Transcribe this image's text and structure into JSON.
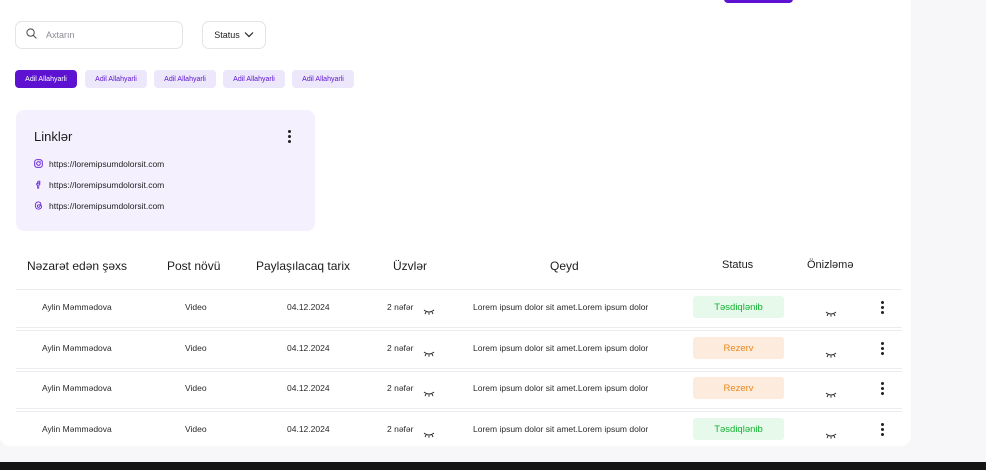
{
  "search": {
    "placeholder": "Axtarın"
  },
  "status_filter": {
    "label": "Status"
  },
  "chips": [
    "Adil Allahyarli",
    "Adil Allahyarli",
    "Adil Allahyarli",
    "Adil Allahyarli",
    "Adil Allahyarli"
  ],
  "links_card": {
    "title": "Linklər",
    "links": [
      {
        "icon": "instagram-icon",
        "url": "https://loremipsumdolorsit.com"
      },
      {
        "icon": "facebook-icon",
        "url": "https://loremipsumdolorsit.com"
      },
      {
        "icon": "threads-icon",
        "url": "https://loremipsumdolorsit.com"
      }
    ]
  },
  "table": {
    "headers": [
      "Nəzarət edən şəxs",
      "Post növü",
      "Paylaşılacaq tarix",
      "Üzvlər",
      "Qeyd",
      "Status",
      "Önizləmə"
    ],
    "rows": [
      {
        "person": "Aylin Məmmədova",
        "type": "Video",
        "date": "04.12.2024",
        "members": "2 nəfər",
        "note": "Lorem ipsum dolor sit amet.Lorem ipsum dolor",
        "status": "Təsdiqlənib",
        "status_kind": "approved"
      },
      {
        "person": "Aylin Məmmədova",
        "type": "Video",
        "date": "04.12.2024",
        "members": "2 nəfər",
        "note": "Lorem ipsum dolor sit amet.Lorem ipsum dolor",
        "status": "Rezerv",
        "status_kind": "reserved"
      },
      {
        "person": "Aylin Məmmədova",
        "type": "Video",
        "date": "04.12.2024",
        "members": "2 nəfər",
        "note": "Lorem ipsum dolor sit amet.Lorem ipsum dolor",
        "status": "Rezerv",
        "status_kind": "reserved"
      },
      {
        "person": "Aylin Məmmədova",
        "type": "Video",
        "date": "04.12.2024",
        "members": "2 nəfər",
        "note": "Lorem ipsum dolor sit amet.Lorem ipsum dolor",
        "status": "Təsdiqlənib",
        "status_kind": "approved"
      }
    ]
  },
  "colors": {
    "accent": "#5d12d2",
    "chip_bg": "#ede7fb",
    "card_bg": "#f4f0fe",
    "approved_text": "#12b331",
    "approved_bg": "#e6f9ea",
    "reserved_text": "#e58a23",
    "reserved_bg": "#fdecdd"
  }
}
